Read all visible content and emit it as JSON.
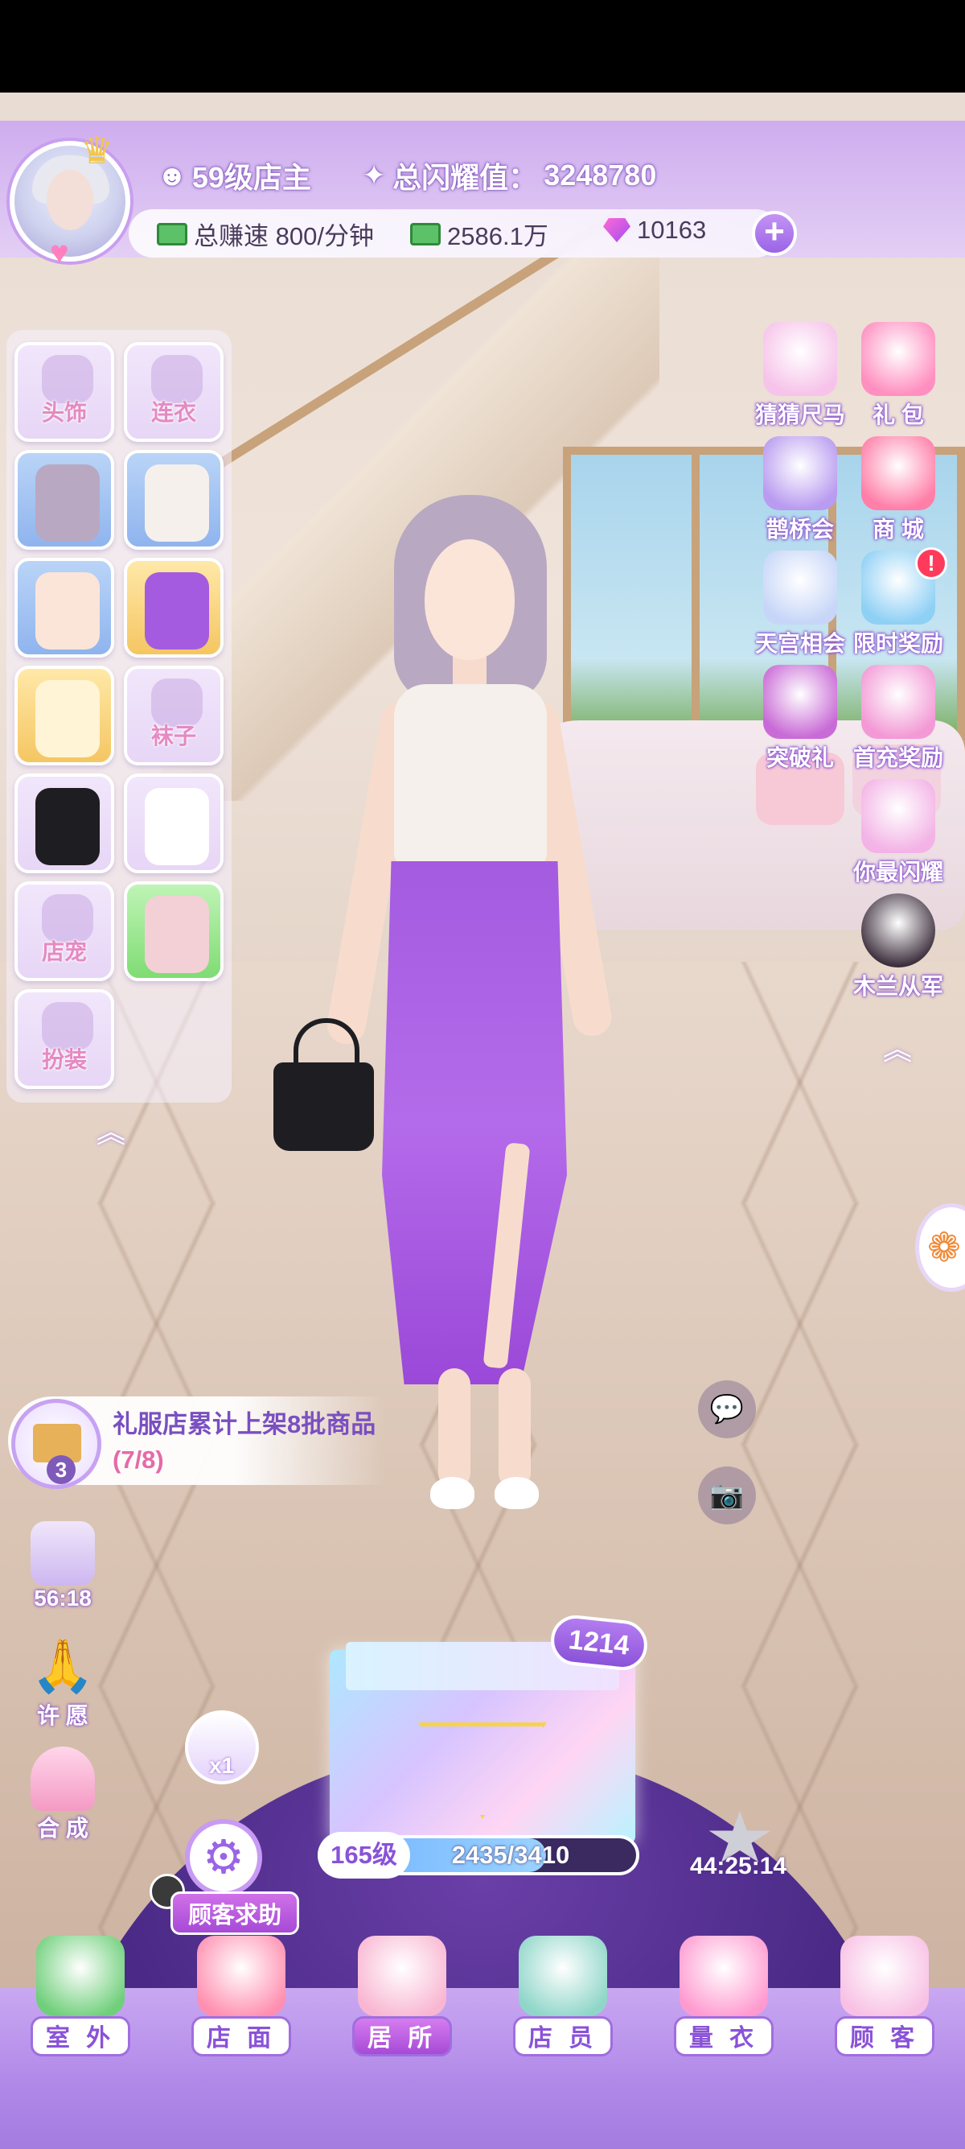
{
  "header": {
    "level_label": "59级店主",
    "shine_label": "总闪耀值：",
    "shine_value": "3248780"
  },
  "resources": {
    "earn_rate": "总赚速 800/分钟",
    "cash": "2586.1万",
    "gems": "10163"
  },
  "wardrobe": {
    "slots": [
      {
        "label": "头饰",
        "state": "empty"
      },
      {
        "label": "连衣",
        "state": "empty"
      },
      {
        "label": "",
        "state": "hair"
      },
      {
        "label": "",
        "state": "top"
      },
      {
        "label": "",
        "state": "face"
      },
      {
        "label": "",
        "state": "skirt"
      },
      {
        "label": "",
        "state": "earrings"
      },
      {
        "label": "袜子",
        "state": "empty"
      },
      {
        "label": "",
        "state": "handbag"
      },
      {
        "label": "",
        "state": "shoes"
      },
      {
        "label": "店宠",
        "state": "empty"
      },
      {
        "label": "",
        "state": "bracelet"
      },
      {
        "label": "扮装",
        "state": "empty"
      }
    ]
  },
  "events": [
    {
      "label": "猜猜尺马",
      "icon": "unicorn-icon",
      "color": "#f7c3ea"
    },
    {
      "label": "礼 包",
      "icon": "gift-box-icon",
      "color": "#ff8fc0"
    },
    {
      "label": "鹊桥会",
      "icon": "magpie-bridge-icon",
      "color": "#b99cf0"
    },
    {
      "label": "商 城",
      "icon": "shop-icon",
      "color": "#ff7fa9"
    },
    {
      "label": "天宫相会",
      "icon": "palace-icon",
      "color": "#c7d6f8"
    },
    {
      "label": "限时奖励",
      "icon": "limited-gift-icon",
      "color": "#8fd0f5"
    },
    {
      "label": "突破礼",
      "icon": "breakthrough-icon",
      "color": "#c96bd6"
    },
    {
      "label": "首充奖励",
      "icon": "balloon-icon",
      "color": "#f39ad6"
    },
    {
      "label": "你最闪耀",
      "icon": "crown-icon",
      "color": "#f3b3e6"
    },
    {
      "label": "木兰从军",
      "icon": "mulan-icon",
      "color": "#3a2c3a"
    }
  ],
  "quest": {
    "count": "3",
    "text": "礼服店累计上架8批商品",
    "progress": "(7/8)"
  },
  "utilities": {
    "timer": "56:18",
    "wish_label": "许 愿",
    "craft_label": "合 成"
  },
  "center": {
    "box_count": "1214",
    "level": "165级",
    "xp_text": "2435/3410",
    "xp_current": 2435,
    "xp_max": 3410,
    "hat_qty": "x1",
    "help_label": "顾客求助",
    "countdown": "44:25:14"
  },
  "nav": [
    {
      "label": "室 外",
      "icon": "palm-tree-icon",
      "active": false
    },
    {
      "label": "店 面",
      "icon": "storefront-icon",
      "active": false
    },
    {
      "label": "居 所",
      "icon": "house-icon",
      "active": true
    },
    {
      "label": "店 员",
      "icon": "staff-icon",
      "active": false
    },
    {
      "label": "量 衣",
      "icon": "tape-measure-icon",
      "active": false
    },
    {
      "label": "顾 客",
      "icon": "shopping-bag-icon",
      "active": false
    }
  ],
  "colors": {
    "accent": "#9a64e6",
    "label_text": "#e58ac2",
    "quest_text": "#7a4fc0"
  }
}
